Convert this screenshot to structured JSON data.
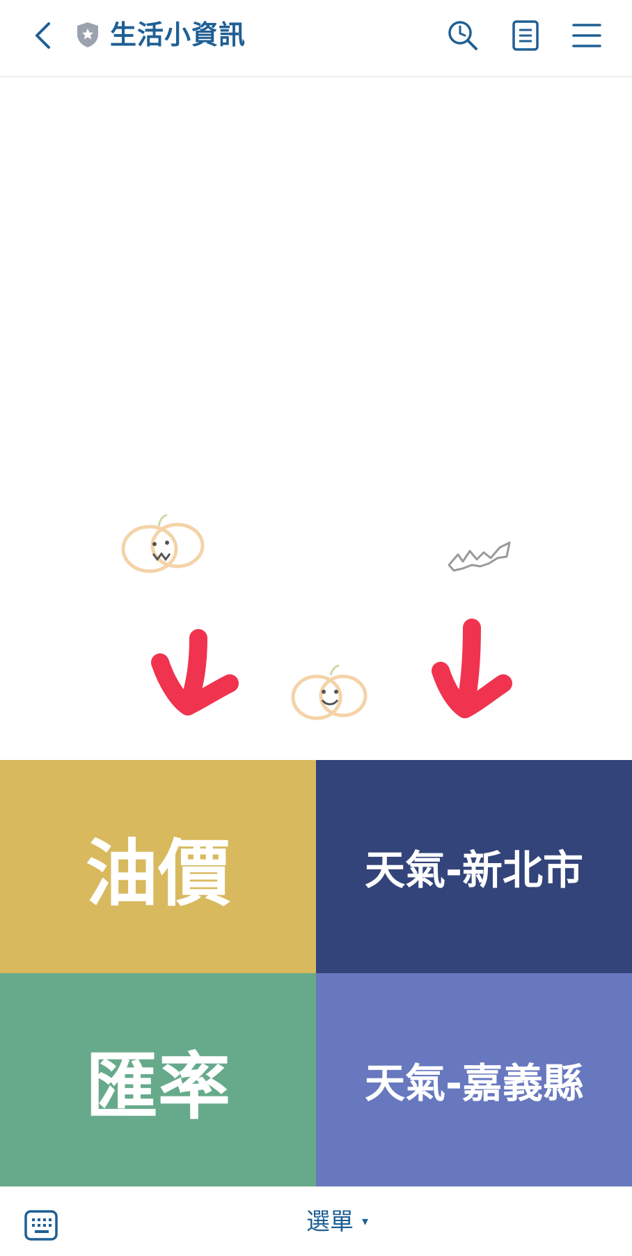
{
  "header": {
    "title": "生活小資訊",
    "icons": [
      "chevron-left-icon",
      "shield-star-icon",
      "clock-search-icon",
      "note-icon",
      "hamburger-menu-icon"
    ]
  },
  "menu_tiles": [
    {
      "label": "油價",
      "color": "#d8b95e"
    },
    {
      "label": "天氣-新北市",
      "color": "#33447a"
    },
    {
      "label": "匯率",
      "color": "#67aa8b"
    },
    {
      "label": "天氣-嘉義縣",
      "color": "#6778bf"
    }
  ],
  "bottom_bar": {
    "menu_label": "選單",
    "caret": "▾",
    "icons": [
      "keyboard-icon"
    ]
  },
  "colors": {
    "accent": "#1f5f94",
    "arrow": "#f0334f"
  }
}
